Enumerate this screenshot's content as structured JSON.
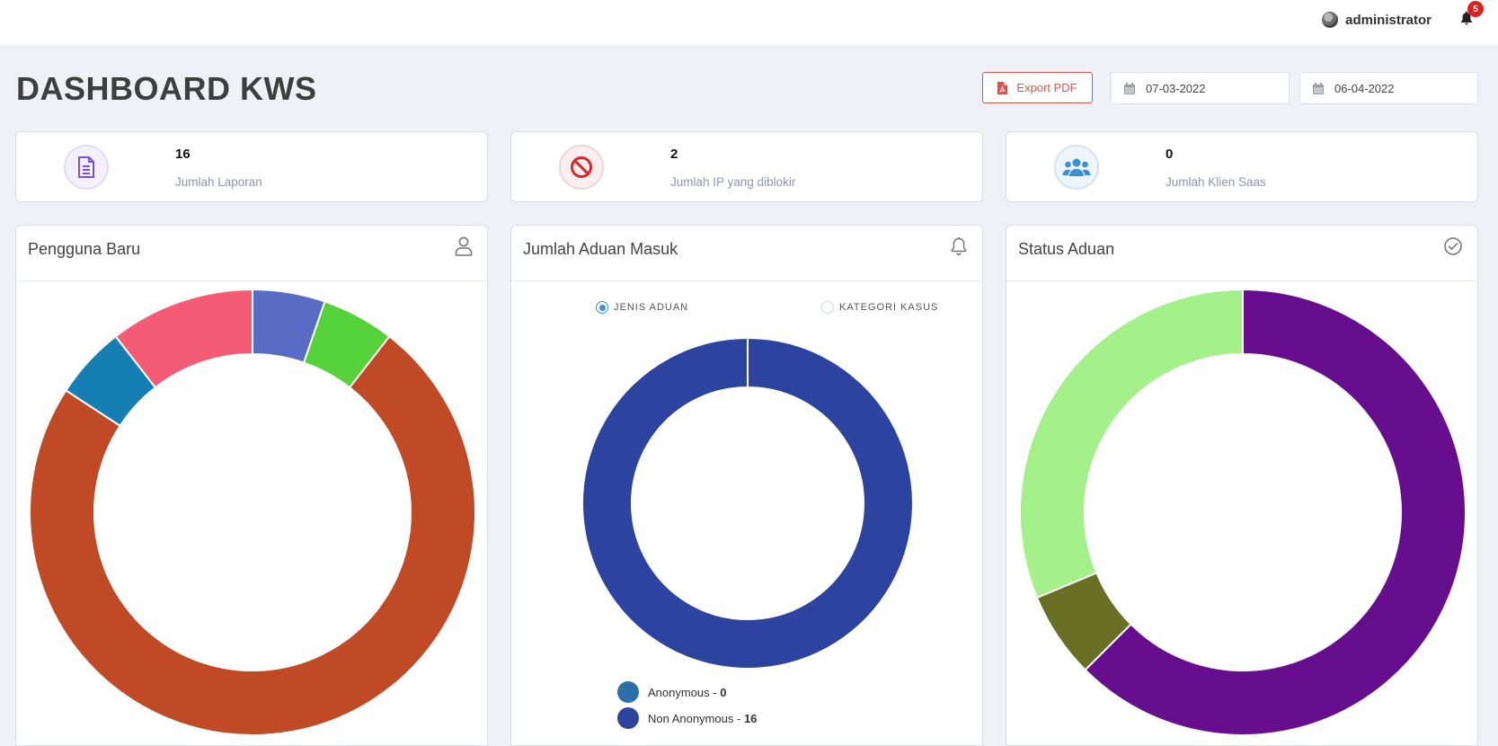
{
  "header": {
    "user_name": "administrator",
    "notification_count": "5"
  },
  "page": {
    "title": "DASHBOARD KWS",
    "export_label": "Export PDF",
    "date_from": "07-03-2022",
    "date_to": "06-04-2022"
  },
  "stats": [
    {
      "value": "16",
      "label": "Jumlah Laporan",
      "icon": "document-icon",
      "color": "#7b4fe3"
    },
    {
      "value": "2",
      "label": "Jumlah IP yang diblokir",
      "icon": "ban-icon",
      "color": "#d9262c"
    },
    {
      "value": "0",
      "label": "Jumlah Klien Saas",
      "icon": "users-icon",
      "color": "#3a8fd8"
    }
  ],
  "cards": {
    "pengguna": {
      "title": "Pengguna Baru",
      "icon": "user-icon"
    },
    "aduan": {
      "title": "Jumlah Aduan Masuk",
      "icon": "bell-outline-icon",
      "radio_jenis": "JENIS ADUAN",
      "radio_kategori": "KATEGORI KASUS",
      "selected": "JENIS ADUAN",
      "legend": [
        {
          "label": "Anonymous - ",
          "value": "0",
          "color": "#2b6fa8"
        },
        {
          "label": "Non Anonymous - ",
          "value": "16",
          "color": "#2d43a0"
        }
      ]
    },
    "status": {
      "title": "Status Aduan",
      "icon": "check-circle-icon"
    }
  },
  "chart_data": [
    {
      "type": "pie",
      "title": "Pengguna Baru",
      "values": [
        1,
        1,
        14,
        1,
        2
      ],
      "colors": [
        "#5a6bc6",
        "#55d13a",
        "#c04a26",
        "#157fb4",
        "#f35c74"
      ]
    },
    {
      "type": "pie",
      "title": "Jumlah Aduan Masuk",
      "categories": [
        "Anonymous",
        "Non Anonymous"
      ],
      "values": [
        0,
        16
      ],
      "colors": [
        "#2b6fa8",
        "#2d43a0"
      ]
    },
    {
      "type": "pie",
      "title": "Status Aduan",
      "values": [
        10,
        1,
        5
      ],
      "colors": [
        "#660e8d",
        "#6a6f26",
        "#a4f08b"
      ]
    }
  ]
}
